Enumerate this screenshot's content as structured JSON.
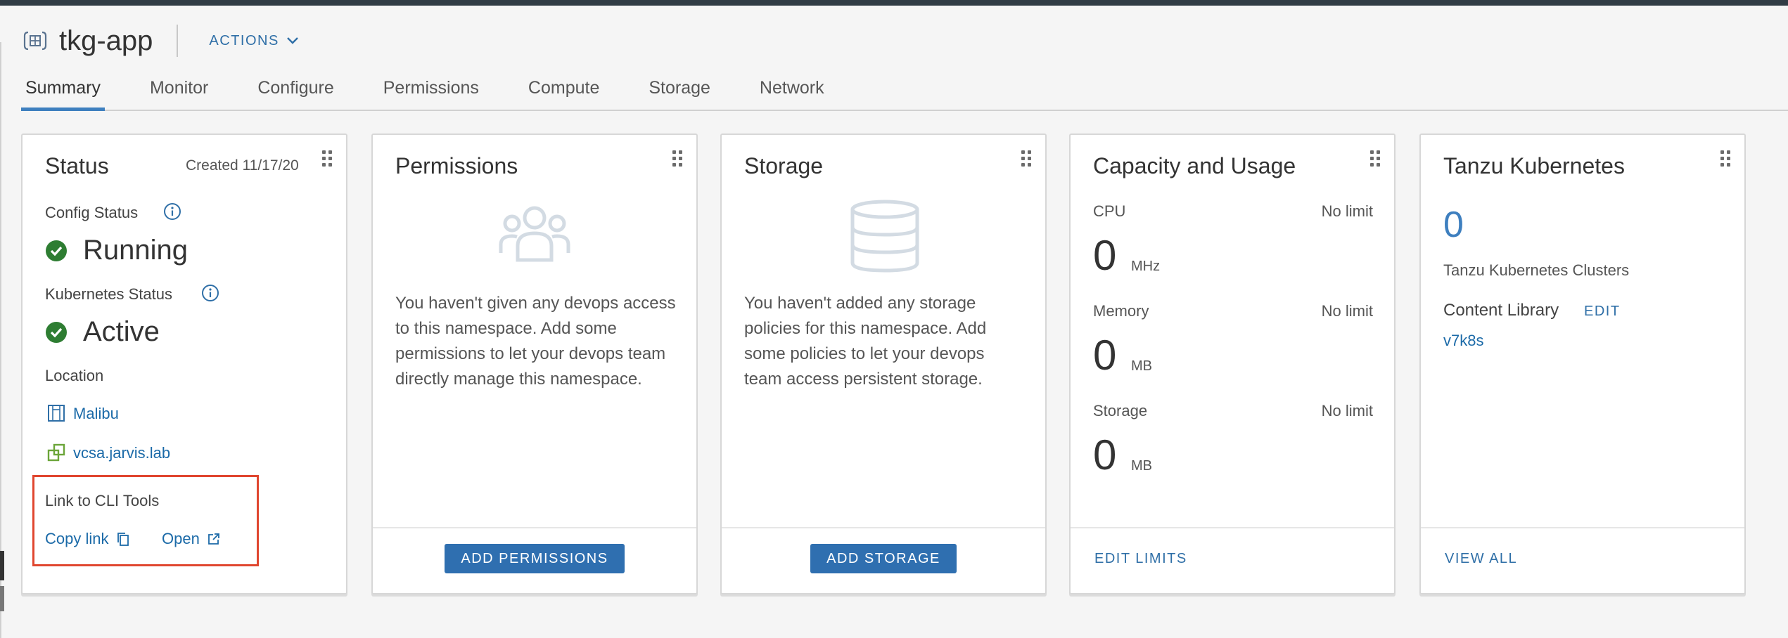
{
  "header": {
    "title": "tkg-app",
    "title_icon": "namespace-icon",
    "actions_label": "ACTIONS",
    "actions_icon": "chevron-down-icon"
  },
  "tabs": [
    {
      "label": "Summary",
      "active": true
    },
    {
      "label": "Monitor",
      "active": false
    },
    {
      "label": "Configure",
      "active": false
    },
    {
      "label": "Permissions",
      "active": false
    },
    {
      "label": "Compute",
      "active": false
    },
    {
      "label": "Storage",
      "active": false
    },
    {
      "label": "Network",
      "active": false
    }
  ],
  "status_card": {
    "title": "Status",
    "created": "Created 11/17/20",
    "config_status_label": "Config Status",
    "config_status_value": "Running",
    "kubernetes_status_label": "Kubernetes Status",
    "kubernetes_status_value": "Active",
    "location_label": "Location",
    "location_datacenter": "Malibu",
    "location_vcenter": "vcsa.jarvis.lab",
    "cli_label": "Link to CLI Tools",
    "copy_link": "Copy link",
    "open_link": "Open"
  },
  "permissions_card": {
    "title": "Permissions",
    "message": "You haven't given any devops access to this namespace. Add some permissions to let your devops team directly manage this namespace.",
    "button": "ADD PERMISSIONS"
  },
  "storage_card": {
    "title": "Storage",
    "message": "You haven't added any storage policies for this namespace. Add some policies to let your devops team access persistent storage.",
    "button": "ADD STORAGE"
  },
  "capacity_card": {
    "title": "Capacity and Usage",
    "cpu": {
      "label": "CPU",
      "limit": "No limit",
      "value": "0",
      "unit": "MHz"
    },
    "memory": {
      "label": "Memory",
      "limit": "No limit",
      "value": "0",
      "unit": "MB"
    },
    "storage": {
      "label": "Storage",
      "limit": "No limit",
      "value": "0",
      "unit": "MB"
    },
    "button": "EDIT LIMITS"
  },
  "tanzu_card": {
    "title": "Tanzu Kubernetes",
    "cluster_count": "0",
    "clusters_label": "Tanzu Kubernetes Clusters",
    "content_library_label": "Content Library",
    "edit_label": "EDIT",
    "library_name": "v7k8s",
    "button": "VIEW ALL"
  },
  "colors": {
    "accent": "#2f6fb0",
    "link": "#1b6aa8",
    "success": "#2e7d32",
    "highlight": "#e0462f"
  }
}
